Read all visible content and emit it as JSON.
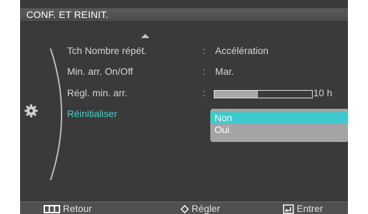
{
  "title": "CONF. ET REINIT.",
  "menu": {
    "items": [
      {
        "label": "Tch Nombre répét.",
        "value": "Accélération"
      },
      {
        "label": "Min. arr. On/Off",
        "value": "Mar."
      },
      {
        "label": "Régl. min. arr.",
        "value": "10 h",
        "progress": 0.45
      },
      {
        "label": "Réinitialiser",
        "value": ""
      }
    ]
  },
  "dropdown": {
    "options": [
      "Non",
      "Oui"
    ],
    "selected": "Non"
  },
  "footer": {
    "back": "Retour",
    "adjust": "Régler",
    "enter": "Entrer"
  },
  "colors": {
    "active": "#3fd1d1",
    "background": "#3a3a3a",
    "dropdown": "#a4a4a4"
  },
  "icons": [
    "up-arrow-icon",
    "gear-icon",
    "menu-icon",
    "up-down-icon",
    "enter-icon"
  ]
}
